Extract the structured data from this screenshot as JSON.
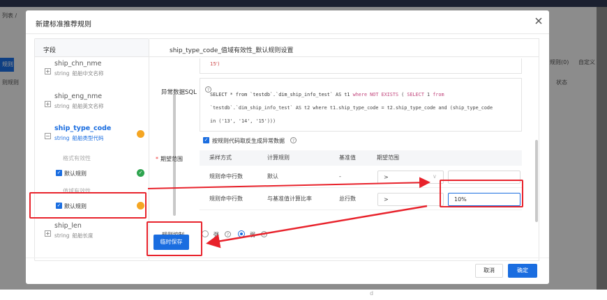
{
  "background": {
    "crumb": "列表 /",
    "blue_btn": "规则",
    "row_label": "则规则",
    "tab_rules": "规则(0)",
    "tab_custom": "自定义",
    "col_status": "状态",
    "bottom_text": "d"
  },
  "modal": {
    "title": "新建标准推荐规则",
    "left_header": "字段",
    "right_header": "ship_type_code_值域有效性_默认规则设置"
  },
  "fields": [
    {
      "name": "ship_chn_nme",
      "type": "string",
      "desc": "船舶中文名称"
    },
    {
      "name": "ship_eng_nme",
      "type": "string",
      "desc": "船舶英文名称"
    },
    {
      "name": "ship_type_code",
      "type": "string",
      "desc": "船舶类型代码"
    },
    {
      "name": "ship_len",
      "type": "string",
      "desc": "船舶长度"
    }
  ],
  "subgroups": {
    "format": "格式有效性",
    "format_rule": "默认规则",
    "domain": "值域有效性",
    "domain_rule": "默认规则"
  },
  "sql": {
    "top_snippet": "15')",
    "label": "异常数据SQL",
    "line1": [
      "SELECT * from `testdb`.`dim_ship_info_test` AS t1 ",
      "where NOT EXISTS",
      " ( ",
      "SELECT",
      " 1 ",
      "from"
    ],
    "line2": "`testdb`.`dim_ship_info_test` AS t2 where t1.ship_type_code = t2.ship_type_code and (ship_type_code",
    "line3": "in ('13', '14', '15')))"
  },
  "generate_checkbox": "按规则代码取反生成异常数据",
  "expected_range": {
    "label": "期望范围",
    "headers": [
      "采样方式",
      "计算规则",
      "基准值",
      "期望范围"
    ],
    "rows": [
      {
        "method": "规则命中行数",
        "rule": "默认",
        "base": "-",
        "op": ">",
        "value": ""
      },
      {
        "method": "规则命中行数",
        "rule": "与基准值计算比率",
        "base": "总行数",
        "op": ">",
        "value": "10%"
      }
    ]
  },
  "control": {
    "label": "规则控制",
    "strong": "强",
    "weak": "弱"
  },
  "buttons": {
    "temp_save": "临时保存",
    "cancel": "取消",
    "ok": "确定"
  },
  "colors": {
    "primary": "#1a6de0",
    "warning": "#f5a623",
    "success": "#2ea44f",
    "annotation": "#e8222b"
  }
}
